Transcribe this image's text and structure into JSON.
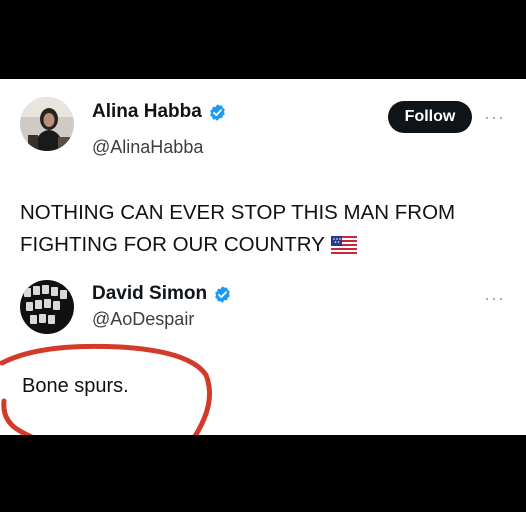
{
  "tweet": {
    "author_name": "Alina Habba",
    "author_handle": "@AlinaHabba",
    "follow_label": "Follow",
    "more_label": "···",
    "text": "NOTHING CAN EVER STOP THIS MAN FROM FIGHTING FOR OUR COUNTRY"
  },
  "reply": {
    "author_name": "David Simon",
    "author_handle": "@AoDespair",
    "more_label": "···",
    "text": "Bone spurs."
  },
  "colors": {
    "verified_blue": "#1d9bf0",
    "annotation_red": "#d23a2a",
    "button_dark": "#0f1419"
  },
  "icons": {
    "verified": "verified-badge-icon",
    "more": "more-options-icon",
    "flag": "us-flag-emoji-icon"
  }
}
